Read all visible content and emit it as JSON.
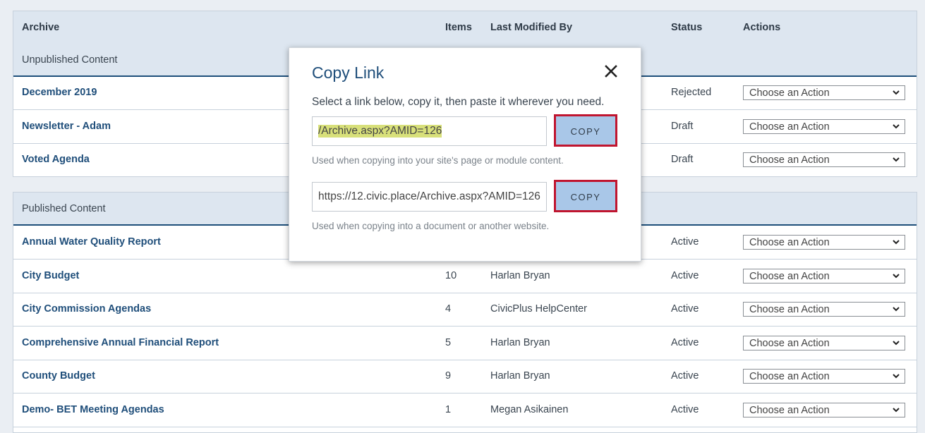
{
  "table": {
    "columns": {
      "archive": "Archive",
      "items": "Items",
      "modified_by": "Last Modified By",
      "status": "Status",
      "actions": "Actions"
    },
    "action_placeholder": "Choose an Action"
  },
  "unpublished": {
    "heading": "Unpublished Content",
    "rows": [
      {
        "title": "December 2019",
        "items": "",
        "modified_by": "",
        "status": "Rejected"
      },
      {
        "title": "Newsletter - Adam",
        "items": "",
        "modified_by": "",
        "status": "Draft"
      },
      {
        "title": "Voted Agenda",
        "items": "",
        "modified_by": "",
        "status": "Draft"
      }
    ]
  },
  "published": {
    "heading": "Published Content",
    "rows": [
      {
        "title": "Annual Water Quality Report",
        "items": "",
        "modified_by": "",
        "status": "Active"
      },
      {
        "title": "City Budget",
        "items": "10",
        "modified_by": "Harlan Bryan",
        "status": "Active"
      },
      {
        "title": "City Commission Agendas",
        "items": "4",
        "modified_by": "CivicPlus HelpCenter",
        "status": "Active"
      },
      {
        "title": "Comprehensive Annual Financial Report",
        "items": "5",
        "modified_by": "Harlan Bryan",
        "status": "Active"
      },
      {
        "title": "County Budget",
        "items": "9",
        "modified_by": "Harlan Bryan",
        "status": "Active"
      },
      {
        "title": "Demo- BET Meeting Agendas",
        "items": "1",
        "modified_by": "Megan Asikainen",
        "status": "Active"
      }
    ]
  },
  "modal": {
    "title": "Copy Link",
    "instructions": "Select a link below, copy it, then paste it wherever you need.",
    "relative_link": "/Archive.aspx?AMID=126",
    "relative_help": "Used when copying into your site's page or module content.",
    "absolute_link": "https://12.civic.place/Archive.aspx?AMID=126",
    "absolute_help": "Used when copying into a document or another website.",
    "copy_label": "COPY",
    "highlight_color": "#c0152f"
  }
}
